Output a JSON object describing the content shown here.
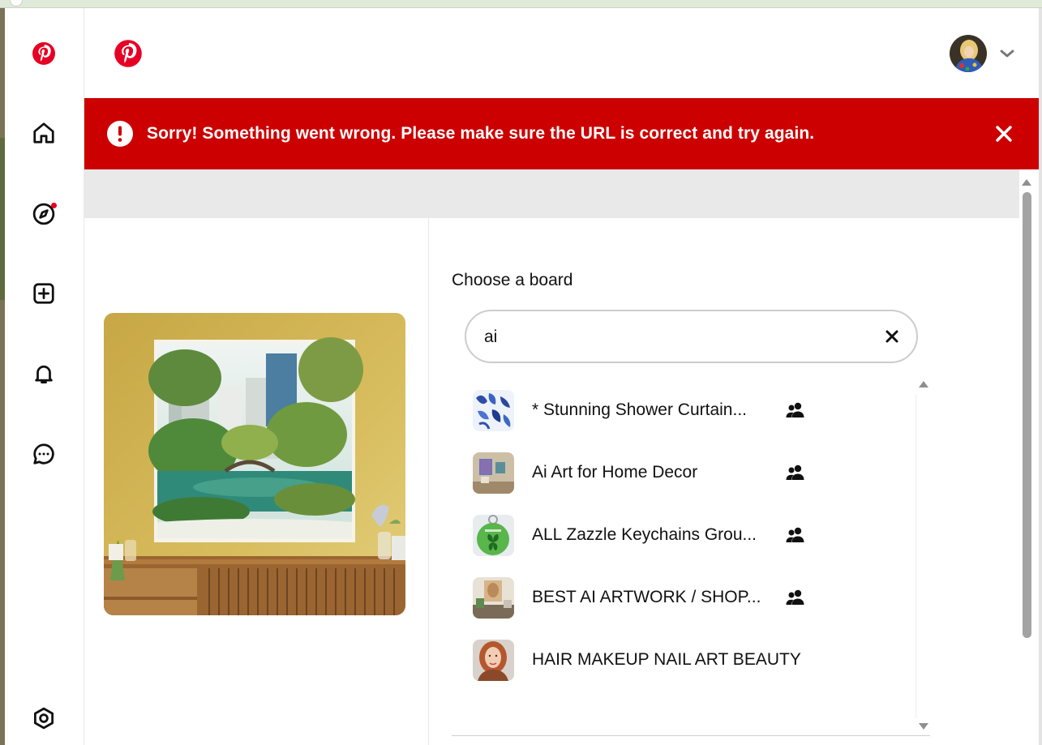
{
  "app": {
    "brand": "Pinterest",
    "colors": {
      "brand_red": "#e60023",
      "error_red": "#cc0000",
      "icon": "#111111"
    }
  },
  "sidebar": {
    "items": [
      {
        "icon": "pinterest-logo-icon"
      },
      {
        "icon": "home-icon"
      },
      {
        "icon": "explore-compass-icon",
        "has_notification": true
      },
      {
        "icon": "create-plus-icon"
      },
      {
        "icon": "bell-icon"
      },
      {
        "icon": "messages-icon"
      },
      {
        "icon": "settings-icon"
      }
    ]
  },
  "header": {
    "logo_icon": "pinterest-logo-icon",
    "avatar_icon": "user-avatar",
    "menu_icon": "chevron-down-icon"
  },
  "error_banner": {
    "message": "Sorry! Something went wrong. Please make sure the URL is correct and try again.",
    "icon": "alert-icon",
    "close_icon": "close-icon"
  },
  "save_modal": {
    "title": "Choose a board",
    "search": {
      "value": "ai",
      "clear_icon": "clear-icon"
    },
    "boards": [
      {
        "name": "* Stunning Shower Curtain...",
        "collaborative": true,
        "thumb": "blue-floral-thumb"
      },
      {
        "name": "Ai Art for Home Decor",
        "collaborative": true,
        "thumb": "room-decor-thumb"
      },
      {
        "name": "ALL Zazzle Keychains Grou...",
        "collaborative": true,
        "thumb": "green-keychain-thumb"
      },
      {
        "name": "BEST AI ARTWORK / SHOP...",
        "collaborative": true,
        "thumb": "artwork-thumb"
      },
      {
        "name": "HAIR MAKEUP NAIL ART BEAUTY",
        "collaborative": false,
        "thumb": "portrait-thumb"
      }
    ]
  }
}
